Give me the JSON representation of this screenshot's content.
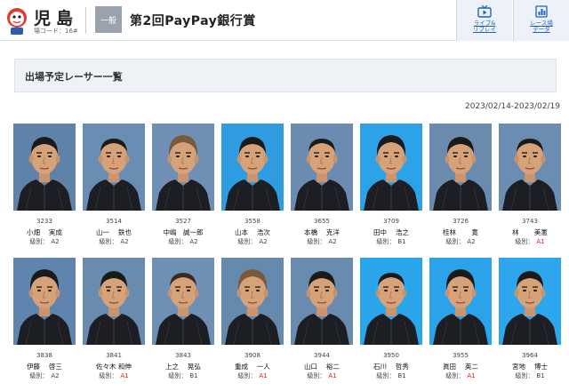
{
  "header": {
    "venue_name": "児島",
    "venue_code": "場コード：16#",
    "grade_label": "一般",
    "race_title": "第2回PayPay銀行賞",
    "buttons": [
      {
        "label": "ライブ&\nリプレイ",
        "icon": "tv-icon"
      },
      {
        "label": "レース場\nデータ",
        "icon": "bar-chart-icon"
      }
    ]
  },
  "section": {
    "title": "出場予定レーサー一覧",
    "date_range": "2023/02/14-2023/02/19",
    "class_label": "級別："
  },
  "racers": [
    {
      "no": "3233",
      "name": "小畑　 実成",
      "class": "A2",
      "bg": "#5e82a8"
    },
    {
      "no": "3514",
      "name": "山一　 鉄也",
      "class": "A2",
      "bg": "#6a8db3"
    },
    {
      "no": "3527",
      "name": "中嶋　誠一郎",
      "class": "A2",
      "bg": "#6f90b4"
    },
    {
      "no": "3558",
      "name": "山本　 浩次",
      "class": "A2",
      "bg": "#2f9be0"
    },
    {
      "no": "3655",
      "name": "本橋　 克洋",
      "class": "A2",
      "bg": "#6b8cb0"
    },
    {
      "no": "3709",
      "name": "田中　 浩之",
      "class": "B1",
      "bg": "#2ea2e8"
    },
    {
      "no": "3726",
      "name": "桂林　　 寛",
      "class": "A2",
      "bg": "#6a8bae"
    },
    {
      "no": "3743",
      "name": "林　　 美憲",
      "class": "A1",
      "bg": "#6c8db2"
    },
    {
      "no": "3838",
      "name": "伊藤　 啓三",
      "class": "A2",
      "bg": "#5f84ad"
    },
    {
      "no": "3841",
      "name": "佐々木 和伸",
      "class": "A1",
      "bg": "#6a8bb0"
    },
    {
      "no": "3843",
      "name": "上之　 晃弘",
      "class": "B1",
      "bg": "#6e90b5"
    },
    {
      "no": "3908",
      "name": "重成　 一人",
      "class": "A1",
      "bg": "#6689ae"
    },
    {
      "no": "3944",
      "name": "山口　 裕二",
      "class": "A1",
      "bg": "#698bb0"
    },
    {
      "no": "3950",
      "name": "石川　 哲秀",
      "class": "B1",
      "bg": "#2aa5ec"
    },
    {
      "no": "3955",
      "name": "眞田　 英二",
      "class": "A1",
      "bg": "#2ba3ea"
    },
    {
      "no": "3964",
      "name": "宮地　 博士",
      "class": "B1",
      "bg": "#2da6ee"
    }
  ]
}
